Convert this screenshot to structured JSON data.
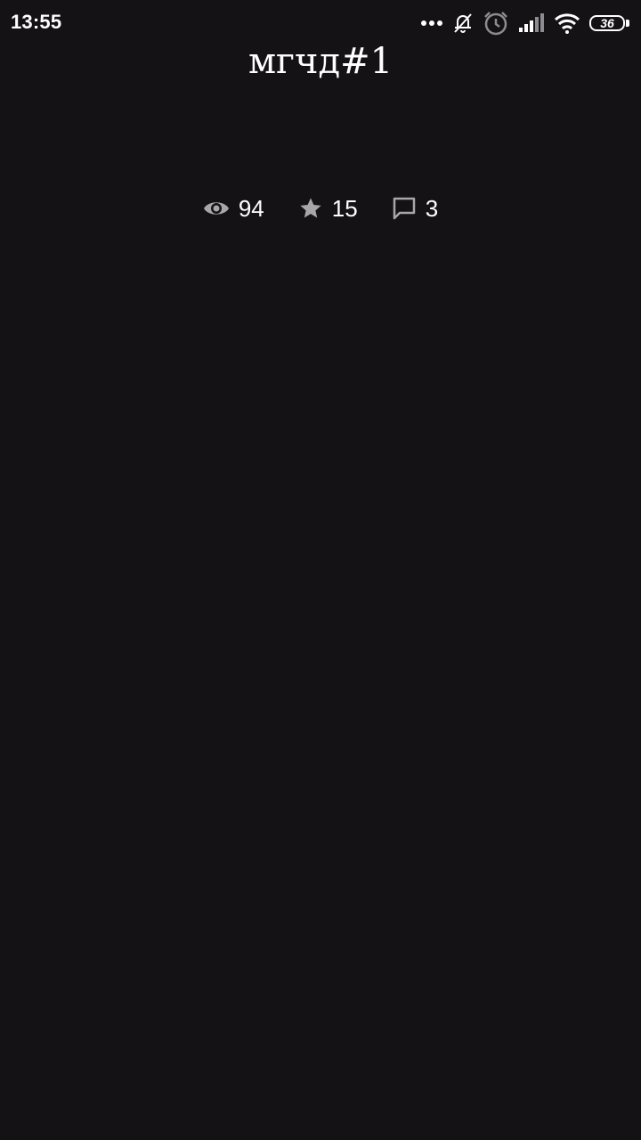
{
  "status_bar": {
    "time": "13:55",
    "battery_level": "36",
    "icons": [
      "more-dots-icon",
      "bell-off-icon",
      "alarm-icon",
      "signal-icon",
      "wifi-icon",
      "battery-icon"
    ]
  },
  "post": {
    "title": "мгчд#1",
    "stats": {
      "views": "94",
      "stars": "15",
      "comments": "3"
    }
  },
  "colors": {
    "background": "#141215",
    "text": "#ffffff",
    "icon": "#a9a6ab"
  }
}
